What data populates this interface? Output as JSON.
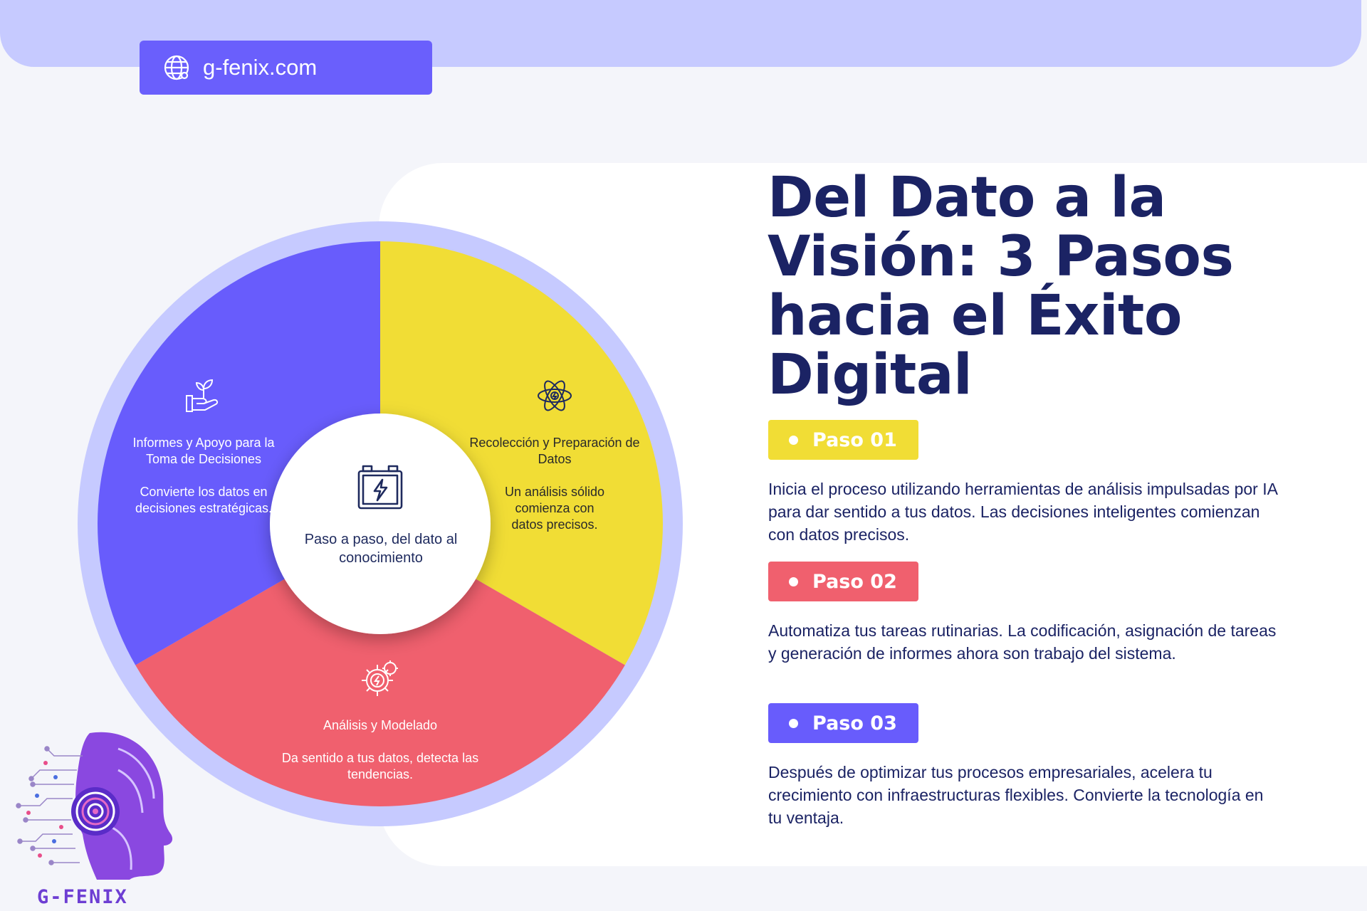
{
  "header": {
    "url_label": "g-fenix.com",
    "icon": "globe-icon"
  },
  "title": "Del Dato a la Visión: 3 Pasos hacia el Éxito Digital",
  "wheel": {
    "center_label": "Paso a paso, del dato al conocimiento",
    "center_icon": "battery-bolt-icon",
    "segments": [
      {
        "title": "Recolección y Preparación de Datos",
        "description": "Un análisis sólido comienza con datos precisos.",
        "color": "#f1dd35",
        "icon": "atom-icon"
      },
      {
        "title": "Análisis y Modelado",
        "description": "Da sentido a tus datos, detecta las tendencias.",
        "color": "#f0606e",
        "icon": "gears-icon"
      },
      {
        "title": "Informes y Apoyo para la Toma de Decisiones",
        "description": "Convierte los datos en decisiones estratégicas.",
        "color": "#685cfc",
        "icon": "plant-hand-icon"
      }
    ],
    "ring_color": "#c6caff"
  },
  "steps": [
    {
      "badge": "Paso 01",
      "color": "#f1dd35",
      "text": "Inicia el proceso utilizando herramientas de análisis impulsadas por IA para dar sentido a tus datos. Las decisiones inteligentes comienzan con datos precisos."
    },
    {
      "badge": "Paso 02",
      "color": "#f0606e",
      "text": "Automatiza tus tareas rutinarias. La codificación, asignación de tareas y generación de informes ahora son trabajo del sistema."
    },
    {
      "badge": "Paso 03",
      "color": "#685cfc",
      "text": "Después de optimizar tus procesos empresariales, acelera tu crecimiento con infraestructuras flexibles. Convierte la tecnología en tu ventaja."
    }
  ],
  "logo": {
    "text": "G-FENIX",
    "icon": "ai-head-icon"
  }
}
